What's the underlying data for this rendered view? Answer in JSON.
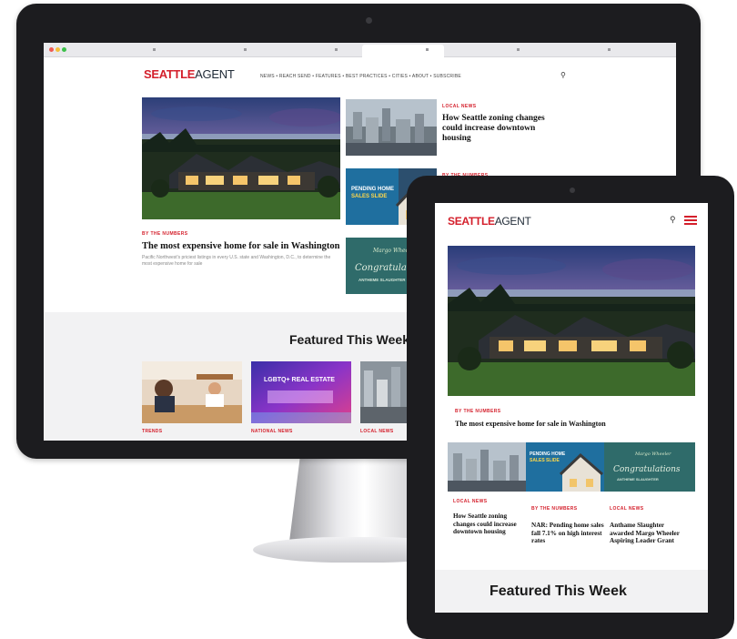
{
  "desktop": {
    "logo": {
      "part1": "SEATTLE",
      "part2": "AGENT"
    },
    "nav_links": "NEWS  •  REACH SEND  •  FEATURES  •  BEST PRACTICES  •  CITIES  •  ABOUT  •  SUBSCRIBE",
    "hero": {
      "kicker": "BY THE NUMBERS",
      "title": "The most expensive home for sale in Washington",
      "description": "Pacific Northwest's priciest listings in every U.S. state and Washington, D.C., to determine the most expensive home for sale"
    },
    "side_stories": [
      {
        "kicker": "LOCAL NEWS",
        "title": "How Seattle zoning changes could increase downtown housing"
      },
      {
        "kicker": "BY THE NUMBERS",
        "promo_text": "PENDING HOME SALES SLIDE"
      },
      {
        "kicker": "",
        "promo_text": "Congratulations ANTHEME SLAUGHTER"
      }
    ],
    "featured_title": "Featured This Week",
    "featured_cards": [
      {
        "kicker": "TRENDS"
      },
      {
        "kicker": "NATIONAL NEWS",
        "banner": "LGBTQ+ REAL ESTATE"
      },
      {
        "kicker": "LOCAL NEWS"
      }
    ]
  },
  "tablet": {
    "logo": {
      "part1": "SEATTLE",
      "part2": "AGENT"
    },
    "hero_kicker": "BY THE NUMBERS",
    "hero_title": "The most expensive home for sale in Washington",
    "strip_promo": "PENDING HOME SALES SLIDE",
    "strip_congrats": "Congratulations ANTHEME SLAUGHTER",
    "columns": [
      {
        "kicker": "LOCAL NEWS",
        "title": "How Seattle zoning changes could increase downtown housing"
      },
      {
        "kicker": "BY THE NUMBERS",
        "title": "NAR: Pending home sales fall 7.1% on high interest rates"
      },
      {
        "kicker": "LOCAL NEWS",
        "title": "Anthame Slaughter awarded Margo Wheeler Aspiring Leader Grant"
      }
    ],
    "featured_title": "Featured This Week"
  },
  "colors": {
    "brand_red": "#d41f2b",
    "device_black": "#1c1c1f",
    "teal": "#2f6b6a"
  }
}
